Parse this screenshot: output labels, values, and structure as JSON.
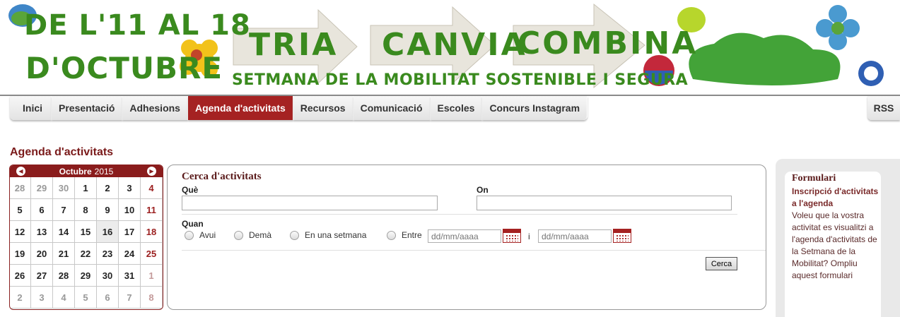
{
  "banner": {
    "dates_line1": "DE L'11 AL 18",
    "dates_line2": "D'OCTUBRE",
    "word1": "TRIA",
    "word2": "CANVIA",
    "word3": "COMBINA",
    "subtitle": "SETMANA DE LA MOBILITAT SOSTENIBLE I SEGURA"
  },
  "nav": {
    "items": [
      {
        "label": "Inici"
      },
      {
        "label": "Presentació"
      },
      {
        "label": "Adhesions"
      },
      {
        "label": "Agenda d'activitats"
      },
      {
        "label": "Recursos"
      },
      {
        "label": "Comunicació"
      },
      {
        "label": "Escoles"
      },
      {
        "label": "Concurs Instagram"
      }
    ],
    "active": "Agenda d'activitats",
    "rss": "RSS"
  },
  "page_title": "Agenda d'activitats",
  "calendar": {
    "month": "Octubre",
    "year": "2015",
    "days": [
      [
        "28",
        "29",
        "30",
        "1",
        "2",
        "3",
        "4"
      ],
      [
        "5",
        "6",
        "7",
        "8",
        "9",
        "10",
        "11"
      ],
      [
        "12",
        "13",
        "14",
        "15",
        "16",
        "17",
        "18"
      ],
      [
        "19",
        "20",
        "21",
        "22",
        "23",
        "24",
        "25"
      ],
      [
        "26",
        "27",
        "28",
        "29",
        "30",
        "31",
        "1"
      ],
      [
        "2",
        "3",
        "4",
        "5",
        "6",
        "7",
        "8"
      ]
    ],
    "today": "16"
  },
  "search": {
    "title": "Cerca d'activitats",
    "que_label": "Què",
    "on_label": "On",
    "quan_label": "Quan",
    "que_value": "",
    "on_value": "",
    "options": [
      "Avui",
      "Demà",
      "En una setmana",
      "Entre"
    ],
    "date_from_placeholder": "dd/mm/aaaa",
    "date_to_placeholder": "dd/mm/aaaa",
    "and_label": "i",
    "button": "Cerca"
  },
  "sidebar": {
    "title": "Formulari",
    "link": "Inscripció d'activitats a l'agenda",
    "description": "Voleu que la vostra activitat es visualitzi a l'agenda d'activitats de la Setmana de la Mobilitat? Ompliu aquest formulari"
  },
  "colors": {
    "accent": "#a52222",
    "green": "#3a8a1e",
    "title": "#7a1a1a"
  }
}
